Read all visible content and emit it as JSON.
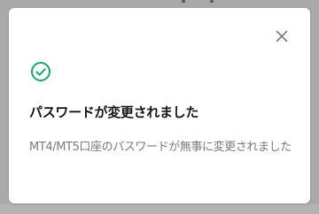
{
  "colors": {
    "success_accent": "#1aa56b",
    "dialog_background": "#ffffff",
    "title_text": "#141414",
    "message_text": "#7a7a7a",
    "overlay": "#a9a9a9"
  },
  "dialog": {
    "title": "パスワードが変更されました",
    "message": "MT4/MT5口座のパスワードが無事に変更されました",
    "status_icon": "check-circle-icon",
    "close_icon": "close-icon"
  }
}
